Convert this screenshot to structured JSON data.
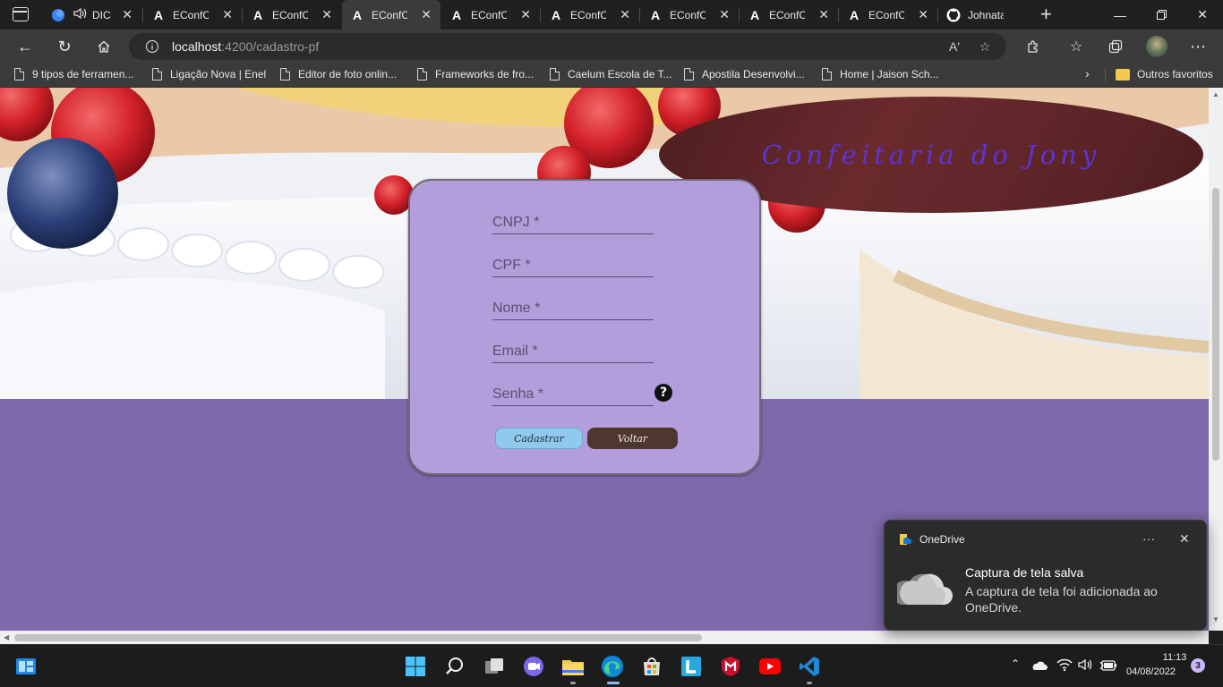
{
  "browser": {
    "tabs": [
      {
        "title": "DIC",
        "icon": "app-icon",
        "audio": true,
        "active": false
      },
      {
        "title": "EConfCo",
        "icon": "angular-icon",
        "active": false
      },
      {
        "title": "EConfCo",
        "icon": "angular-icon",
        "active": false
      },
      {
        "title": "EConfCo",
        "icon": "angular-icon",
        "active": true
      },
      {
        "title": "EConfCo",
        "icon": "angular-icon",
        "active": false
      },
      {
        "title": "EConfCo",
        "icon": "angular-icon",
        "active": false
      },
      {
        "title": "EConfCo",
        "icon": "angular-icon",
        "active": false
      },
      {
        "title": "EConfCo",
        "icon": "angular-icon",
        "active": false
      },
      {
        "title": "EConfCo",
        "icon": "angular-icon",
        "active": false
      },
      {
        "title": "Johnatan",
        "icon": "github-icon",
        "active": false
      }
    ],
    "tab_letter": "A",
    "address": {
      "host": "localhost",
      "path": ":4200/cadastro-pf"
    },
    "bookmarks": [
      "9 tipos de ferramen...",
      "Ligação Nova | Enel",
      "Editor de foto onlin...",
      "Frameworks de fro...",
      "Caelum Escola de T...",
      "Apostila Desenvolvi...",
      "Home | Jaison Sch..."
    ],
    "other_favorites": "Outros favoritos",
    "read_aloud_label": "Aʹ"
  },
  "page": {
    "brand": "Confeitaria do Jony",
    "form": {
      "cnpj_placeholder": "CNPJ *",
      "cpf_placeholder": "CPF *",
      "nome_placeholder": "Nome *",
      "email_placeholder": "Email *",
      "senha_placeholder": "Senha *",
      "help_glyph": "?",
      "submit_label": "Cadastrar",
      "back_label": "Voltar"
    }
  },
  "toast": {
    "app": "OneDrive",
    "title": "Captura de tela salva",
    "body": "A captura de tela foi adicionada ao OneDrive.",
    "more_glyph": "···"
  },
  "taskbar": {
    "time": "11:13",
    "date": "04/08/2022",
    "notifications": "3",
    "apps": [
      "start-icon",
      "search-icon",
      "task-view-icon",
      "chat-icon",
      "file-explorer-icon",
      "edge-icon",
      "store-icon",
      "l-app-icon",
      "mcafee-icon",
      "youtube-icon",
      "vscode-icon"
    ]
  },
  "colors": {
    "page_background": "#7e69aa",
    "card_background": "#b39ddb",
    "brand_oval": "#5a2326",
    "brand_text": "#5a34d6",
    "submit_button": "#8fc9ec",
    "back_button": "#4e3731"
  }
}
